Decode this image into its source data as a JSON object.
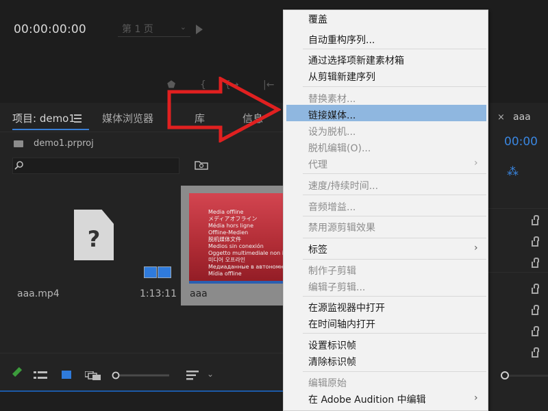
{
  "monitor": {
    "timecode": "00:00:00:00",
    "page_label": "第 1 页",
    "controls": [
      "⬟",
      "{",
      "{→",
      "|←"
    ]
  },
  "tabs": [
    {
      "label": "项目: demo1"
    },
    {
      "label": "媒体浏览器"
    },
    {
      "label": "库"
    },
    {
      "label": "信息"
    }
  ],
  "project": {
    "file": "demo1.prproj",
    "search_placeholder": "",
    "items": [
      {
        "name": "aaa.mp4",
        "duration": "1:13:11"
      },
      {
        "name": "aaa"
      }
    ],
    "offline_lines": [
      "Media offline",
      "メディアオフライン",
      "Média hors ligne",
      "Offline-Medien",
      "脱机媒体文件",
      "Medios sin conexión",
      "Oggetto multimediale non in linea",
      "미디어 오프라인",
      "Медиаданные в автономном режиме",
      "Mídia offline"
    ]
  },
  "sequence": {
    "tab_label": "aaa",
    "close": "×",
    "timecode": "00:00"
  },
  "context_menu": {
    "items": [
      {
        "label": "覆盖",
        "enabled": true
      },
      {
        "label": "自动重构序列...",
        "enabled": true
      },
      {
        "label": "通过选择项新建素材箱",
        "enabled": true
      },
      {
        "label": "从剪辑新建序列",
        "enabled": true
      },
      {
        "label": "替换素材...",
        "enabled": false
      },
      {
        "label": "链接媒体...",
        "enabled": true,
        "highlighted": true
      },
      {
        "label": "设为脱机...",
        "enabled": false
      },
      {
        "label": "脱机编辑(O)...",
        "enabled": false
      },
      {
        "label": "代理",
        "enabled": false,
        "submenu": true
      },
      {
        "label": "速度/持续时间...",
        "enabled": false
      },
      {
        "label": "音频增益...",
        "enabled": false
      },
      {
        "label": "禁用源剪辑效果",
        "enabled": false
      },
      {
        "label": "标签",
        "enabled": true,
        "submenu": true
      },
      {
        "label": "制作子剪辑",
        "enabled": false
      },
      {
        "label": "编辑子剪辑...",
        "enabled": false
      },
      {
        "label": "在源监视器中打开",
        "enabled": true
      },
      {
        "label": "在时间轴内打开",
        "enabled": true
      },
      {
        "label": "设置标识帧",
        "enabled": true
      },
      {
        "label": "清除标识帧",
        "enabled": true
      },
      {
        "label": "编辑原始",
        "enabled": false
      },
      {
        "label": "在 Adobe Audition 中编辑",
        "enabled": true,
        "submenu": true
      }
    ],
    "submenu_glyph": "›"
  },
  "colors": {
    "highlight": "#8fb7e0",
    "arrow": "#e02020",
    "accent_blue": "#3a86e0"
  }
}
